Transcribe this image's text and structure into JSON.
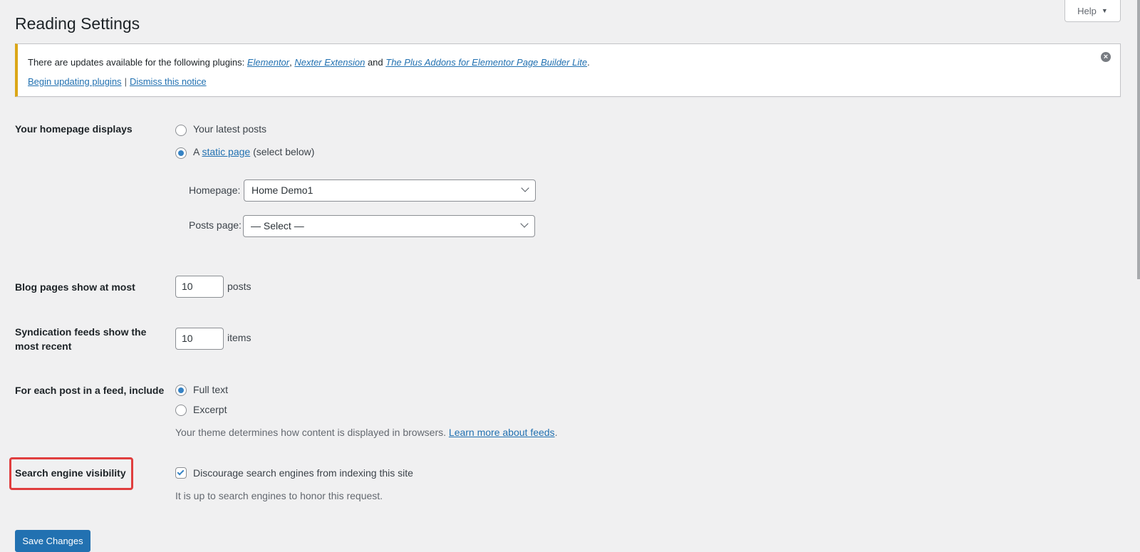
{
  "page": {
    "title": "Reading Settings",
    "help_label": "Help",
    "help_caret": "▼"
  },
  "notice": {
    "prefix": "There are updates available for the following plugins: ",
    "plugins": [
      "Elementor",
      "Nexter Extension",
      "The Plus Addons for Elementor Page Builder Lite"
    ],
    "comma": ", ",
    "and": " and ",
    "period": ".",
    "begin_link": "Begin updating plugins",
    "separator": "|",
    "dismiss_link": "Dismiss this notice",
    "close_icon": "×",
    "accent_color": "#dba617"
  },
  "homepage": {
    "label": "Your homepage displays",
    "options": [
      {
        "label": "Your latest posts",
        "checked": false
      },
      {
        "prefix": "A ",
        "link": "static page",
        "suffix": " (select below)",
        "checked": true
      }
    ],
    "homepage_select": {
      "label": "Homepage:",
      "value": "Home Demo1"
    },
    "posts_page_select": {
      "label": "Posts page:",
      "value": "— Select —"
    }
  },
  "blog_pages": {
    "label": "Blog pages show at most",
    "value": "10",
    "unit": "posts"
  },
  "syndication": {
    "label_line1": "Syndication feeds show the",
    "label_line2": "most recent",
    "value": "10",
    "unit": "items"
  },
  "feed_include": {
    "label": "For each post in a feed, include",
    "options": [
      {
        "label": "Full text",
        "checked": true
      },
      {
        "label": "Excerpt",
        "checked": false
      }
    ],
    "description": "Your theme determines how content is displayed in browsers. ",
    "learn_more_link": "Learn more about feeds",
    "period": "."
  },
  "search_visibility": {
    "label": "Search engine visibility",
    "checkbox_label": "Discourage search engines from indexing this site",
    "checked": true,
    "description": "It is up to search engines to honor this request.",
    "highlight_color": "#e03e3e"
  },
  "actions": {
    "save_label": "Save Changes",
    "primary_color": "#2271b1"
  }
}
